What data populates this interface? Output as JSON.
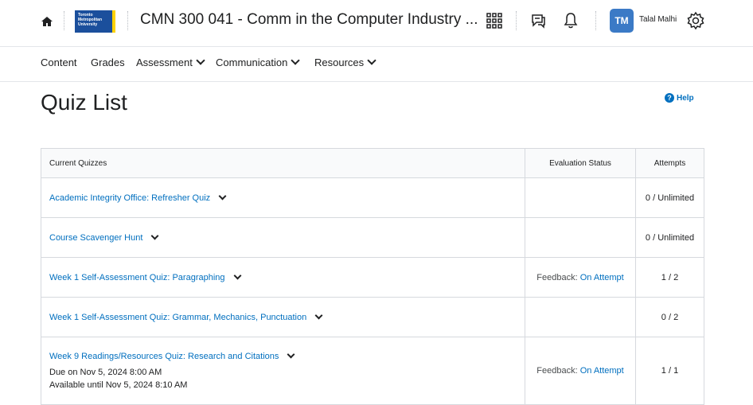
{
  "header": {
    "logo_lines": [
      "Toronto",
      "Metropolitan",
      "University"
    ],
    "course_title": "CMN 300 041 - Comm in the Computer Industry ...",
    "user_initials": "TM",
    "user_name": "Talal Malhi",
    "icons": [
      "home-icon",
      "grid-icon",
      "chat-icon",
      "bell-icon",
      "gear-icon"
    ]
  },
  "nav": {
    "items": [
      "Content",
      "Grades",
      "Assessment",
      "Communication",
      "Resources"
    ]
  },
  "page": {
    "title": "Quiz List",
    "help": "Help"
  },
  "table": {
    "headers": [
      "Current Quizzes",
      "Evaluation Status",
      "Attempts"
    ],
    "rows": [
      {
        "name": "Academic Integrity Office: Refresher Quiz",
        "status_label": "",
        "status_link": "",
        "attempts": "0 / Unlimited"
      },
      {
        "name": "Course Scavenger Hunt",
        "status_label": "",
        "status_link": "",
        "attempts": "0 / Unlimited"
      },
      {
        "name": "Week 1 Self-Assessment Quiz: Paragraphing",
        "status_label": "Feedback:",
        "status_link": "On Attempt",
        "attempts": "1 / 2"
      },
      {
        "name": "Week 1 Self-Assessment Quiz: Grammar, Mechanics, Punctuation",
        "status_label": "",
        "status_link": "",
        "attempts": "0 / 2"
      },
      {
        "name": "Week 9 Readings/Resources Quiz: Research and Citations",
        "status_label": "Feedback:",
        "status_link": "On Attempt",
        "attempts": "1 / 1",
        "due": "Due on Nov 5, 2024 8:00 AM",
        "available": "Available until Nov 5, 2024 8:10 AM"
      }
    ]
  },
  "colors": {
    "link": "#006fbf",
    "avatar": "#3b7ac6",
    "logo_blue": "#1b4f9c",
    "logo_yellow": "#ffd200"
  }
}
